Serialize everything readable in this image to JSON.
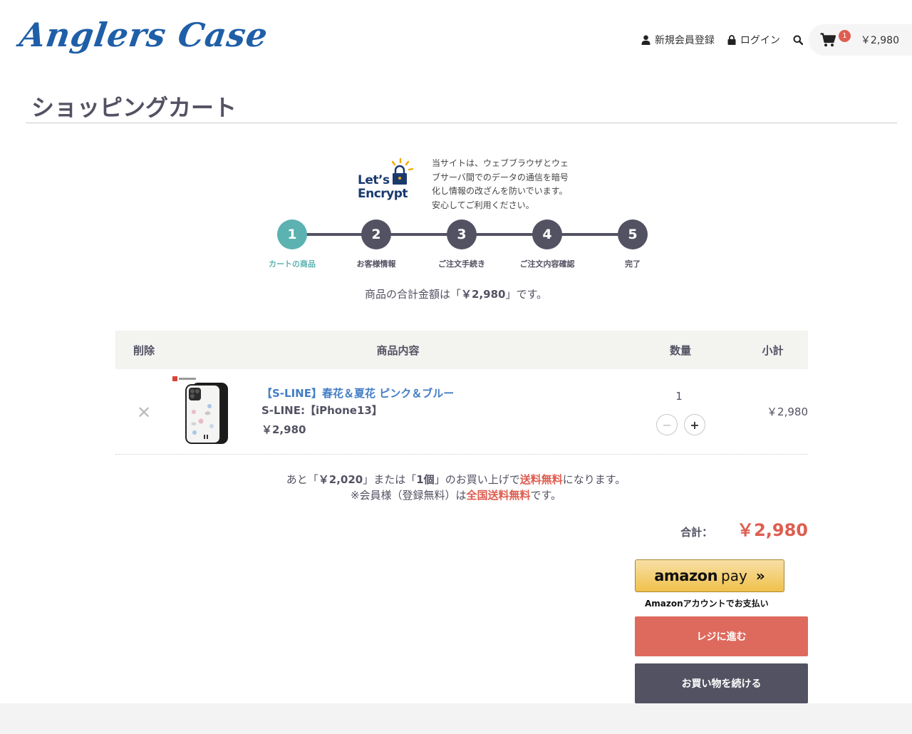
{
  "header": {
    "logo": "Anglers Case",
    "register_label": "新規会員登録",
    "login_label": "ログイン",
    "cart_count": "1",
    "cart_total": "￥2,980",
    "icons": [
      "user-icon",
      "lock-icon",
      "search-icon",
      "cart-icon"
    ]
  },
  "page": {
    "title": "ショッピングカート"
  },
  "ssl": {
    "logo_line1": "Let’s",
    "logo_line2": "Encrypt",
    "text": "当サイトは、ウェブブラウザとウェブサーバ間でのデータの通信を暗号化し情報の改ざんを防いでいます。安心してご利用ください。"
  },
  "steps": [
    {
      "number": "1",
      "label": "カートの商品",
      "active": true
    },
    {
      "number": "2",
      "label": "お客様情報",
      "active": false
    },
    {
      "number": "3",
      "label": "ご注文手続き",
      "active": false
    },
    {
      "number": "4",
      "label": "ご注文内容確認",
      "active": false
    },
    {
      "number": "5",
      "label": "完了",
      "active": false
    }
  ],
  "summary": {
    "prefix": "商品の合計金額は「",
    "amount": "￥2,980",
    "suffix": "」です。"
  },
  "table": {
    "headers": {
      "delete": "削除",
      "item": "商品内容",
      "qty": "数量",
      "subtotal": "小計"
    },
    "rows": [
      {
        "delete_glyph": "✕",
        "name": "【S-LINE】春花＆夏花 ピンク＆ブルー",
        "option": "S-LINE:【iPhone13】",
        "price": "￥2,980",
        "quantity": "1",
        "minus": "−",
        "plus": "+",
        "subtotal": "￥2,980"
      }
    ]
  },
  "shipping": {
    "line1_a": "あと「",
    "line1_amount": "￥2,020",
    "line1_b": "」または「",
    "line1_count": "1個",
    "line1_c": "」のお買い上げで",
    "line1_free": "送料無料",
    "line1_d": "になります。",
    "line2_a": "※会員様（登録無料）は",
    "line2_free": "全国送料無料",
    "line2_b": "です。"
  },
  "total": {
    "label": "合計：",
    "value": "￥2,980"
  },
  "amazon": {
    "brand": "amazon",
    "pay": "pay",
    "chevrons": "»",
    "note": "Amazonアカウントでお支払い"
  },
  "buttons": {
    "checkout": "レジに進む",
    "continue": "お買い物を続ける"
  },
  "colors": {
    "accent_teal": "#5cb1b1",
    "dark": "#525263",
    "red": "#de5d50",
    "link_blue": "#437ec4",
    "logo_blue": "#1f5fa8"
  }
}
